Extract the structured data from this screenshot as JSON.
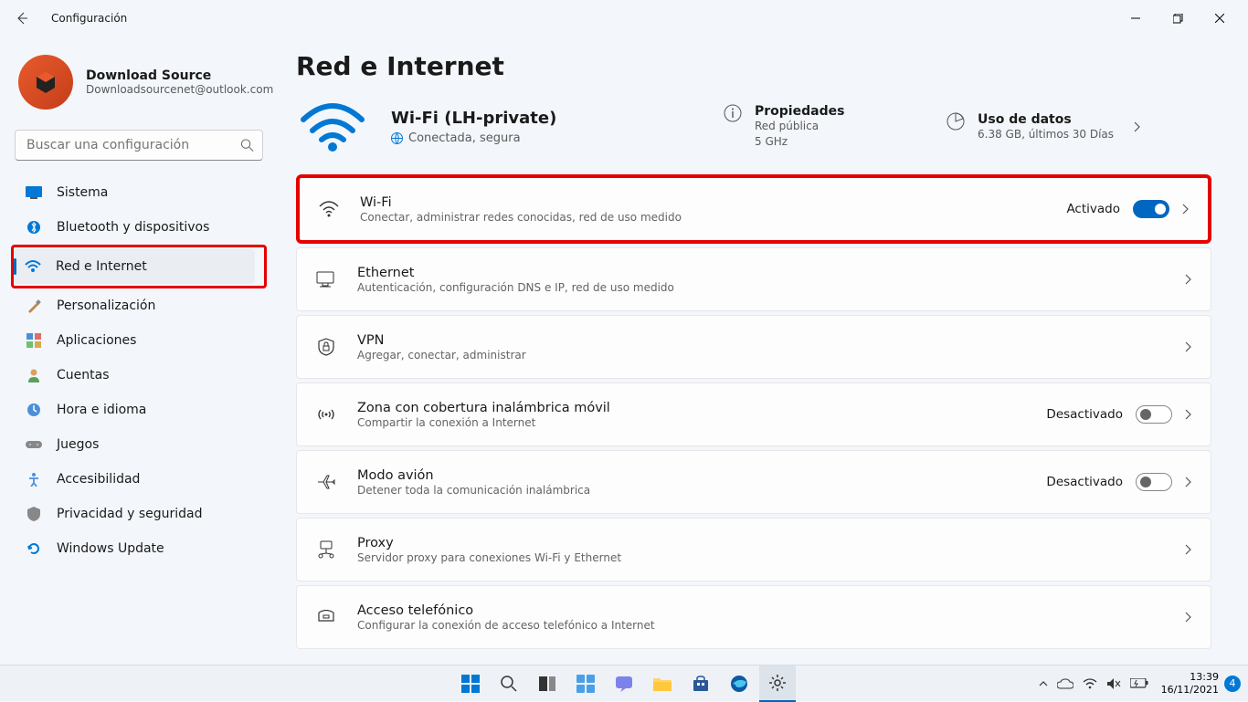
{
  "window": {
    "title": "Configuración"
  },
  "user": {
    "name": "Download Source",
    "email": "Downloadsourcenet@outlook.com"
  },
  "search": {
    "placeholder": "Buscar una configuración"
  },
  "sidebar": {
    "items": [
      {
        "label": "Sistema"
      },
      {
        "label": "Bluetooth y dispositivos"
      },
      {
        "label": "Red e Internet"
      },
      {
        "label": "Personalización"
      },
      {
        "label": "Aplicaciones"
      },
      {
        "label": "Cuentas"
      },
      {
        "label": "Hora e idioma"
      },
      {
        "label": "Juegos"
      },
      {
        "label": "Accesibilidad"
      },
      {
        "label": "Privacidad y seguridad"
      },
      {
        "label": "Windows Update"
      }
    ]
  },
  "page": {
    "title": "Red e Internet"
  },
  "status": {
    "network_title": "Wi-Fi (LH-private)",
    "network_sub": "Conectada, segura",
    "properties_title": "Propiedades",
    "properties_line1": "Red pública",
    "properties_line2": "5 GHz",
    "data_title": "Uso de datos",
    "data_sub": "6.38 GB, últimos 30 Días"
  },
  "settings": {
    "wifi": {
      "title": "Wi-Fi",
      "desc": "Conectar, administrar redes conocidas, red de uso medido",
      "state": "Activado"
    },
    "ethernet": {
      "title": "Ethernet",
      "desc": "Autenticación, configuración DNS e IP, red de uso medido"
    },
    "vpn": {
      "title": "VPN",
      "desc": "Agregar, conectar, administrar"
    },
    "hotspot": {
      "title": "Zona con cobertura inalámbrica móvil",
      "desc": "Compartir la conexión a Internet",
      "state": "Desactivado"
    },
    "airplane": {
      "title": "Modo avión",
      "desc": "Detener toda la comunicación inalámbrica",
      "state": "Desactivado"
    },
    "proxy": {
      "title": "Proxy",
      "desc": "Servidor proxy para conexiones Wi-Fi y Ethernet"
    },
    "dialup": {
      "title": "Acceso telefónico",
      "desc": "Configurar la conexión de acceso telefónico a Internet"
    }
  },
  "taskbar": {
    "time": "13:39",
    "date": "16/11/2021",
    "notifications": "4"
  }
}
